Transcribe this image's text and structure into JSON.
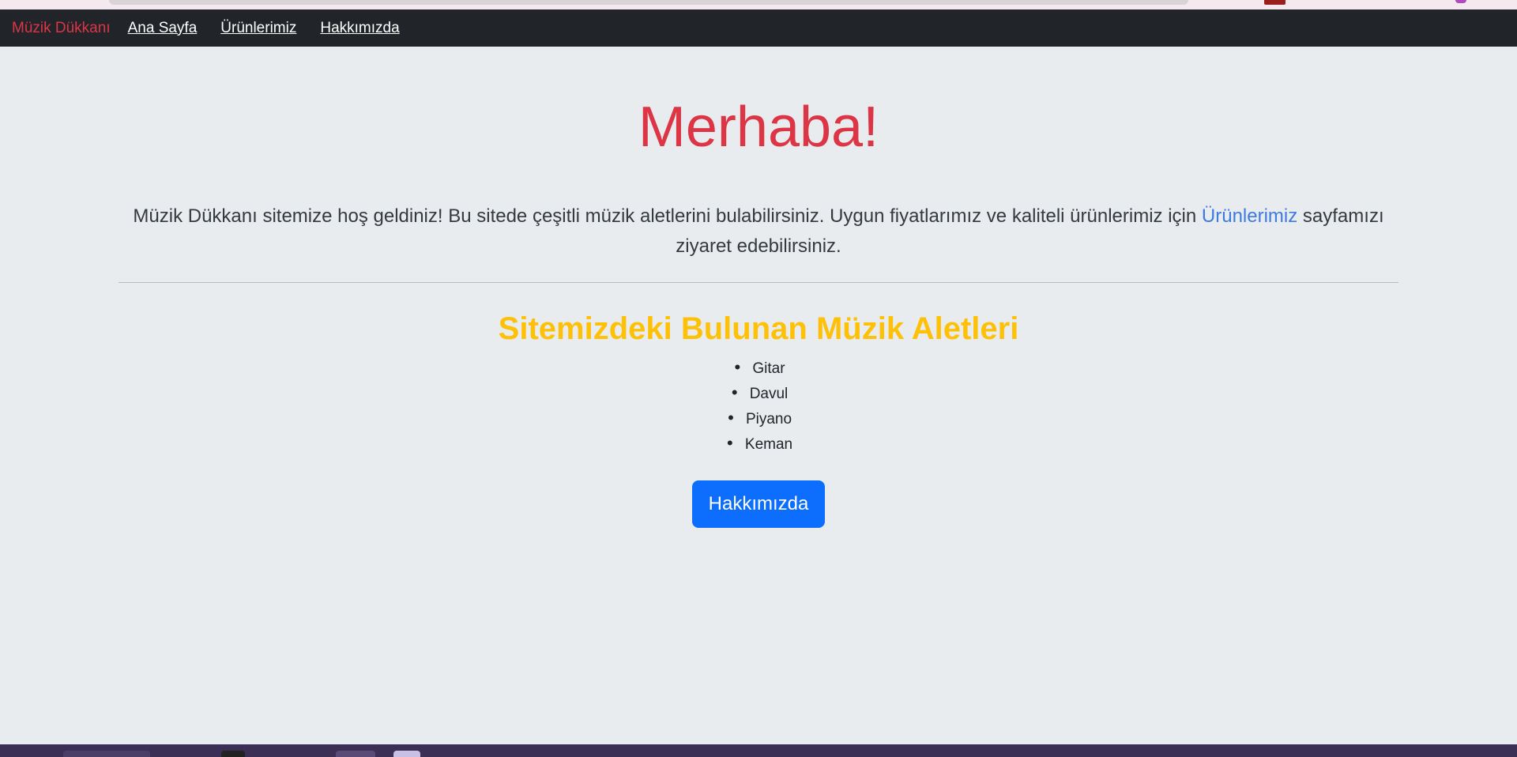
{
  "navbar": {
    "brand": "Müzik Dükkanı",
    "links": [
      "Ana Sayfa",
      "Ürünlerimiz",
      "Hakkımızda"
    ]
  },
  "hero": {
    "title": "Merhaba!",
    "lead_before": "Müzik Dükkanı sitemize hoş geldiniz! Bu sitede çeşitli müzik aletlerini bulabilirsiniz. Uygun fiyatlarımız ve kaliteli ürünlerimiz için ",
    "lead_link": "Ürünlerimiz",
    "lead_after": " sayfamızı ziyaret edebilirsiniz."
  },
  "section": {
    "title": "Sitemizdeki Bulunan Müzik Aletleri",
    "items": [
      "Gitar",
      "Davul",
      "Piyano",
      "Keman"
    ]
  },
  "button": {
    "label": "Hakkımızda"
  },
  "colors": {
    "brand": "#dc3545",
    "navbar_bg": "#212529",
    "page_bg": "#e9ecef",
    "section_title": "#ffc107",
    "button_bg": "#0d6efd",
    "link": "#3d7be0"
  }
}
